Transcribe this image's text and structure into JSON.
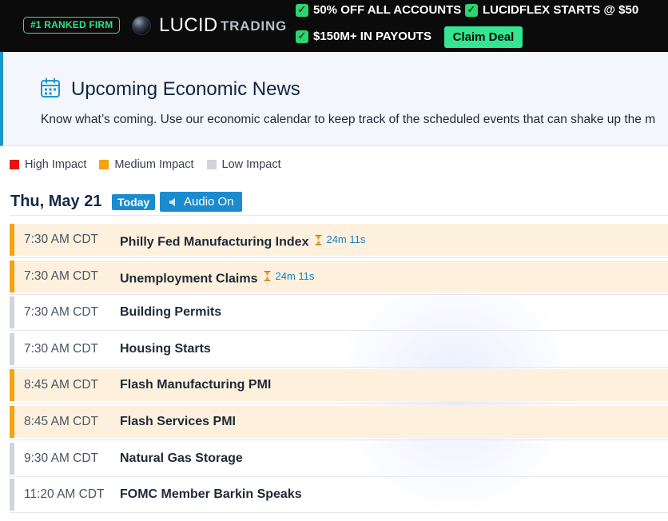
{
  "topbar": {
    "rank_badge": "#1 RANKED FIRM",
    "logo_main": "LUCID",
    "logo_sub": "TRADING",
    "promos": [
      "50% OFF ALL ACCOUNTS",
      "LUCIDFLEX STARTS @ $50",
      "$150M+ IN PAYOUTS"
    ],
    "claim_label": "Claim Deal",
    "accent_color": "#35e58f"
  },
  "header": {
    "icon": "calendar-icon",
    "title": "Upcoming Economic News",
    "description": "Know what’s coming. Use our economic calendar to keep track of the scheduled events that can shake up the m",
    "accent_color": "#1e97d0"
  },
  "legend": {
    "high": "High Impact",
    "medium": "Medium Impact",
    "low": "Low Impact",
    "colors": {
      "high": "#e81010",
      "medium": "#f5a410",
      "low": "#d1d5db"
    }
  },
  "day": {
    "title": "Thu, May 21",
    "today_label": "Today",
    "audio_label": "Audio On"
  },
  "events": [
    {
      "time": "7:30 AM CDT",
      "name": "Philly Fed Manufacturing Index",
      "impact": "medium",
      "countdown": "24m 11s"
    },
    {
      "time": "7:30 AM CDT",
      "name": "Unemployment Claims",
      "impact": "medium",
      "countdown": "24m 11s"
    },
    {
      "time": "7:30 AM CDT",
      "name": "Building Permits",
      "impact": "low",
      "countdown": ""
    },
    {
      "time": "7:30 AM CDT",
      "name": "Housing Starts",
      "impact": "low",
      "countdown": ""
    },
    {
      "time": "8:45 AM CDT",
      "name": "Flash Manufacturing PMI",
      "impact": "medium",
      "countdown": ""
    },
    {
      "time": "8:45 AM CDT",
      "name": "Flash Services PMI",
      "impact": "medium",
      "countdown": ""
    },
    {
      "time": "9:30 AM CDT",
      "name": "Natural Gas Storage",
      "impact": "low",
      "countdown": ""
    },
    {
      "time": "11:20 AM CDT",
      "name": "FOMC Member Barkin Speaks",
      "impact": "low",
      "countdown": ""
    }
  ]
}
